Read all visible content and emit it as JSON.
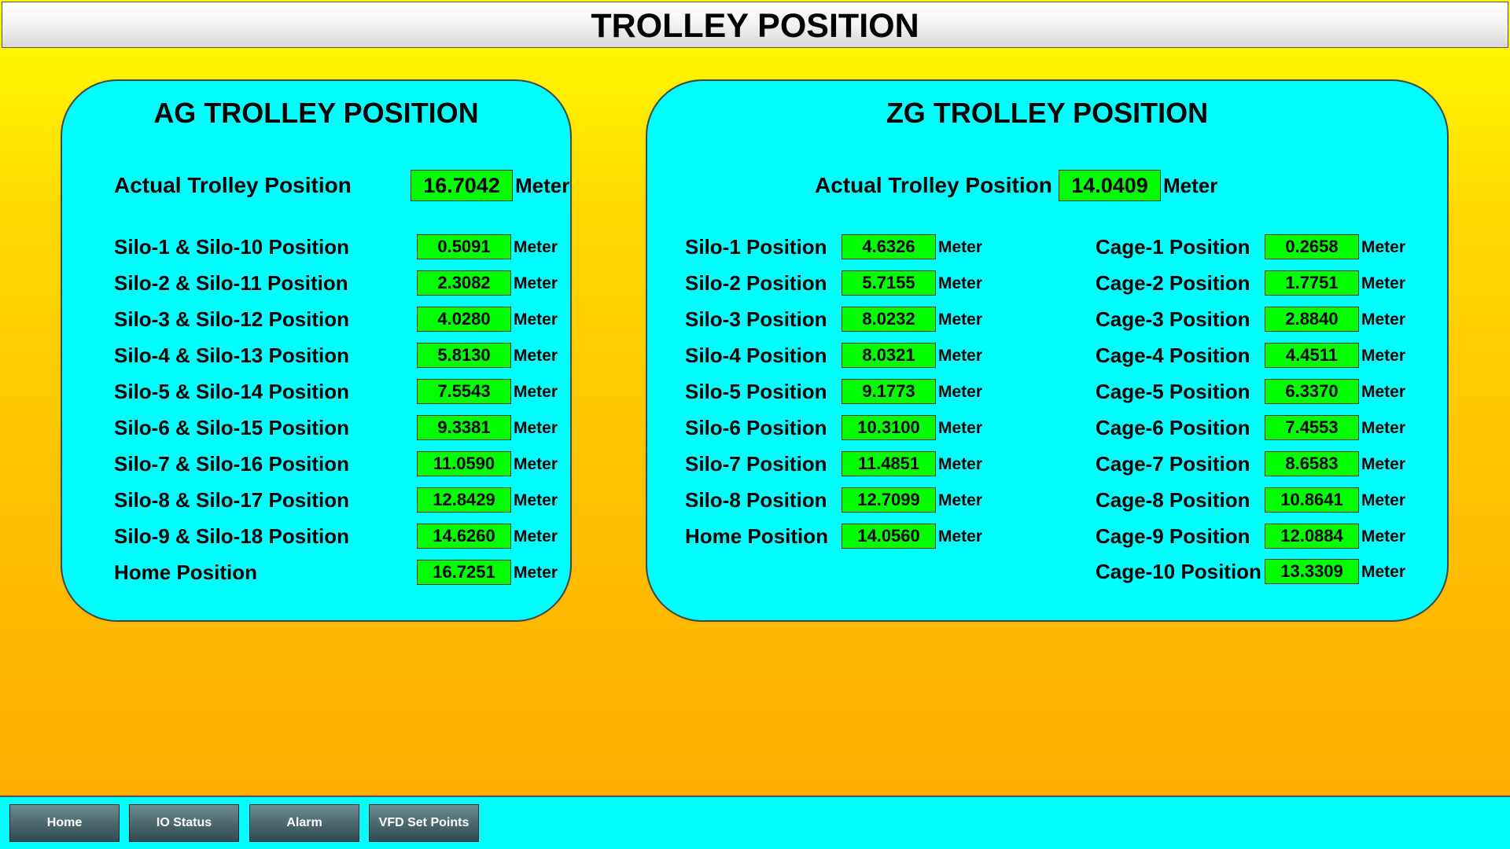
{
  "title": "TROLLEY POSITION",
  "ag": {
    "title": "AG TROLLEY POSITION",
    "actual": {
      "label": "Actual Trolley Position",
      "value": "16.7042",
      "unit": "Meter"
    },
    "rows": [
      {
        "label": "Silo-1 & Silo-10 Position",
        "value": "0.5091",
        "unit": "Meter"
      },
      {
        "label": "Silo-2 & Silo-11 Position",
        "value": "2.3082",
        "unit": "Meter"
      },
      {
        "label": "Silo-3 & Silo-12 Position",
        "value": "4.0280",
        "unit": "Meter"
      },
      {
        "label": "Silo-4 & Silo-13 Position",
        "value": "5.8130",
        "unit": "Meter"
      },
      {
        "label": "Silo-5 & Silo-14 Position",
        "value": "7.5543",
        "unit": "Meter"
      },
      {
        "label": "Silo-6 & Silo-15 Position",
        "value": "9.3381",
        "unit": "Meter"
      },
      {
        "label": "Silo-7 & Silo-16 Position",
        "value": "11.0590",
        "unit": "Meter"
      },
      {
        "label": "Silo-8 & Silo-17 Position",
        "value": "12.8429",
        "unit": "Meter"
      },
      {
        "label": "Silo-9 & Silo-18 Position",
        "value": "14.6260",
        "unit": "Meter"
      },
      {
        "label": "Home Position",
        "value": "16.7251",
        "unit": "Meter"
      }
    ]
  },
  "zg": {
    "title": "ZG TROLLEY POSITION",
    "actual": {
      "label": "Actual Trolley Position",
      "value": "14.0409",
      "unit": "Meter"
    },
    "silos": [
      {
        "label": "Silo-1 Position",
        "value": "4.6326",
        "unit": "Meter"
      },
      {
        "label": "Silo-2 Position",
        "value": "5.7155",
        "unit": "Meter"
      },
      {
        "label": "Silo-3 Position",
        "value": "8.0232",
        "unit": "Meter"
      },
      {
        "label": "Silo-4 Position",
        "value": "8.0321",
        "unit": "Meter"
      },
      {
        "label": "Silo-5 Position",
        "value": "9.1773",
        "unit": "Meter"
      },
      {
        "label": "Silo-6 Position",
        "value": "10.3100",
        "unit": "Meter"
      },
      {
        "label": "Silo-7 Position",
        "value": "11.4851",
        "unit": "Meter"
      },
      {
        "label": "Silo-8 Position",
        "value": "12.7099",
        "unit": "Meter"
      },
      {
        "label": "Home Position",
        "value": "14.0560",
        "unit": "Meter"
      }
    ],
    "cages": [
      {
        "label": "Cage-1 Position",
        "value": "0.2658",
        "unit": "Meter"
      },
      {
        "label": "Cage-2 Position",
        "value": "1.7751",
        "unit": "Meter"
      },
      {
        "label": "Cage-3 Position",
        "value": "2.8840",
        "unit": "Meter"
      },
      {
        "label": "Cage-4 Position",
        "value": "4.4511",
        "unit": "Meter"
      },
      {
        "label": "Cage-5 Position",
        "value": "6.3370",
        "unit": "Meter"
      },
      {
        "label": "Cage-6 Position",
        "value": "7.4553",
        "unit": "Meter"
      },
      {
        "label": "Cage-7 Position",
        "value": "8.6583",
        "unit": "Meter"
      },
      {
        "label": "Cage-8 Position",
        "value": "10.8641",
        "unit": "Meter"
      },
      {
        "label": "Cage-9 Position",
        "value": "12.0884",
        "unit": "Meter"
      },
      {
        "label": "Cage-10 Position",
        "value": "13.3309",
        "unit": "Meter"
      }
    ]
  },
  "nav": {
    "home": "Home",
    "io_status": "IO Status",
    "alarm": "Alarm",
    "vfd_set_points": "VFD Set Points"
  },
  "colors": {
    "background_top": "#ffff00",
    "background_bottom": "#ffab00",
    "panel": "#00ffff",
    "value_box": "#00ff00"
  }
}
